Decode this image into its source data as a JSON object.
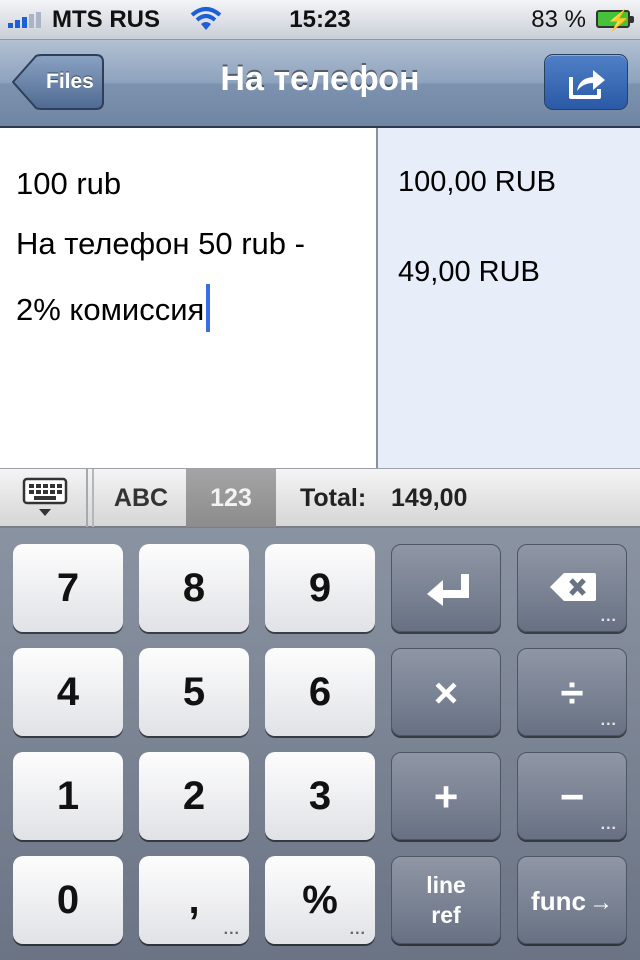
{
  "status_bar": {
    "carrier": "MTS RUS",
    "time": "15:23",
    "battery_pct": "83 %"
  },
  "nav": {
    "back_label": "Files",
    "title": "На телефон"
  },
  "editor": {
    "lines": [
      "100 rub",
      "На телефон 50 rub -",
      "2% комиссия"
    ]
  },
  "results": {
    "lines": [
      "100,00 RUB",
      "49,00 RUB"
    ]
  },
  "toolbar": {
    "mode_abc": "ABC",
    "mode_123": "123",
    "total_label": "Total:",
    "total_value": "149,00"
  },
  "keypad": {
    "dots": "...",
    "digits": [
      "7",
      "8",
      "9",
      "4",
      "5",
      "6",
      "1",
      "2",
      "3",
      "0",
      ",",
      "%"
    ],
    "ops": {
      "multiply": "×",
      "divide": "÷",
      "plus": "+",
      "minus": "−",
      "line": "line",
      "ref": "ref",
      "func": "func"
    },
    "icons": {
      "enter": "enter-icon",
      "backspace": "backspace-icon",
      "arrow": "→"
    }
  }
}
